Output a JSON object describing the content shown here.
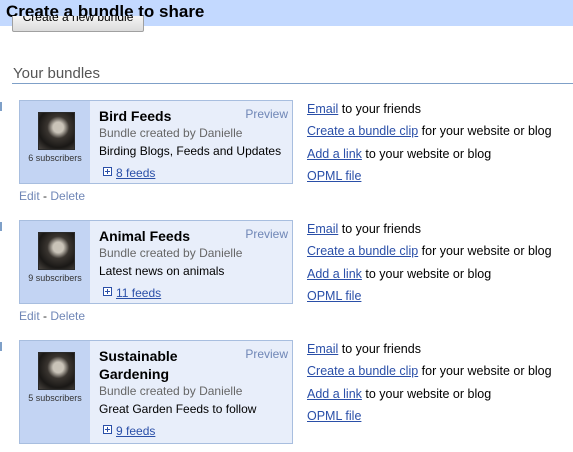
{
  "header": {
    "title": "Create a bundle to share"
  },
  "create_button": {
    "label": "Create a new bundle"
  },
  "section": {
    "title": "Your bundles"
  },
  "common": {
    "preview": "Preview",
    "edit": "Edit",
    "delete": "Delete",
    "edit_sep": "-"
  },
  "share_links": {
    "email": {
      "link": "Email",
      "suffix": " to your friends"
    },
    "clip": {
      "link": "Create a bundle clip",
      "suffix": " for your website or blog"
    },
    "add_link": {
      "link": "Add a link",
      "suffix": " to your website or blog"
    },
    "opml": {
      "link": "OPML file"
    }
  },
  "bundles": [
    {
      "title": "Bird Feeds",
      "created_by": "Bundle created by Danielle",
      "description": "Birding Blogs, Feeds and Updates",
      "feeds": "8 feeds",
      "subscribers": "6 subscribers"
    },
    {
      "title": "Animal Feeds",
      "created_by": "Bundle created by Danielle",
      "description": "Latest news on animals",
      "feeds": "11 feeds",
      "subscribers": "9 subscribers"
    },
    {
      "title_line1": "Sustainable",
      "title_line2": "Gardening",
      "created_by": "Bundle created by Danielle",
      "description": "Great Garden Feeds to follow",
      "feeds": "9 feeds",
      "subscribers": "5 subscribers"
    }
  ]
}
